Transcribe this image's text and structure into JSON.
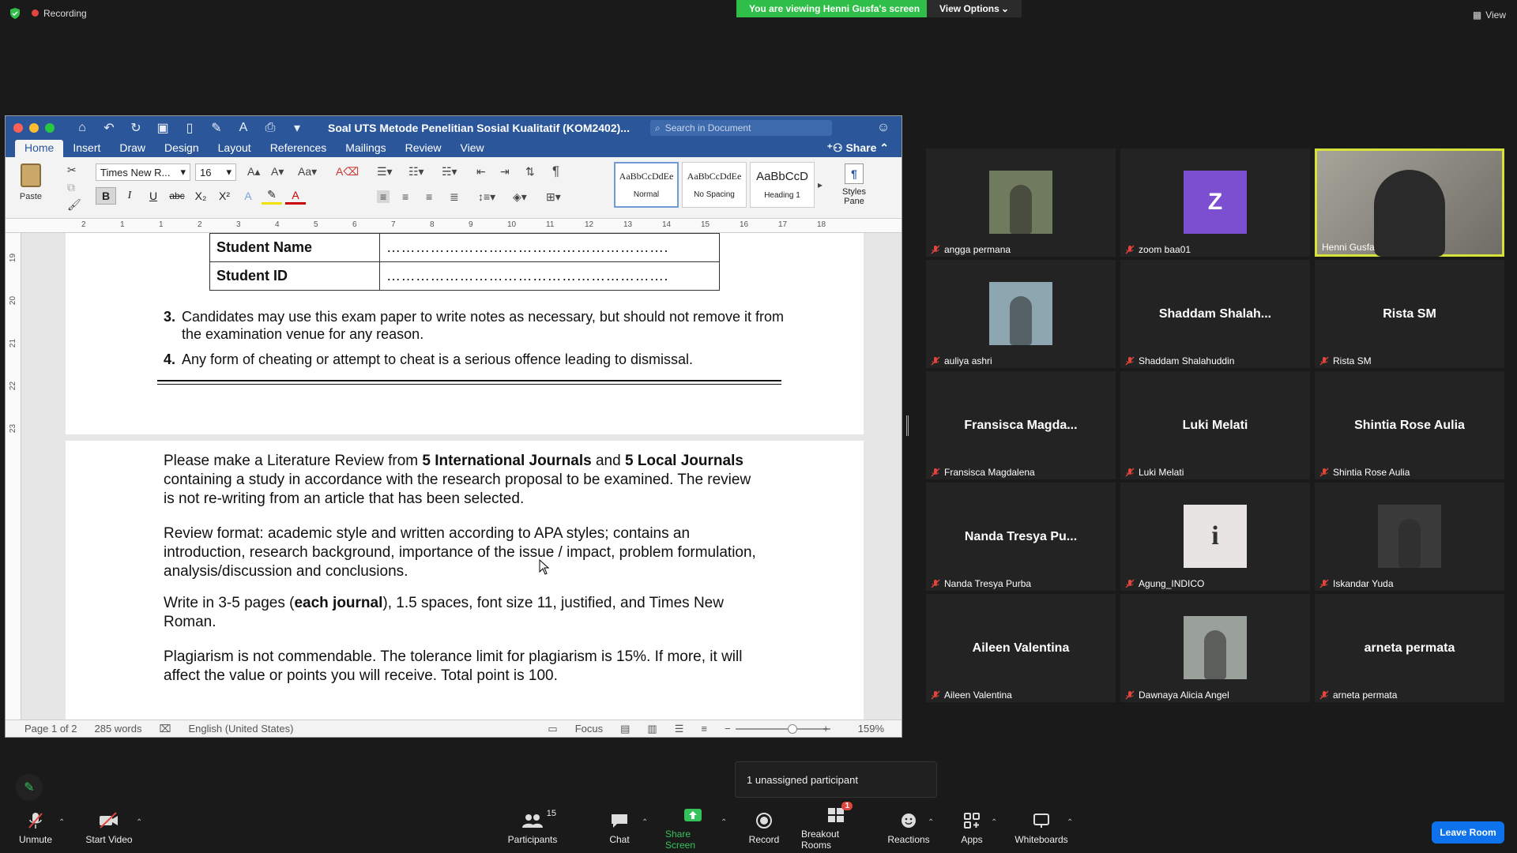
{
  "zoom": {
    "recording_label": "Recording",
    "viewing_banner": "You are viewing Henni Gusfa's screen",
    "view_options": "View Options",
    "view_label": "View",
    "popup": "1 unassigned participant",
    "leave_room": "Leave Room",
    "toolbar": {
      "unmute": "Unmute",
      "start_video": "Start Video",
      "participants": "Participants",
      "participants_count": "15",
      "chat": "Chat",
      "share_screen": "Share Screen",
      "record": "Record",
      "breakout_rooms": "Breakout Rooms",
      "breakout_badge": "1",
      "reactions": "Reactions",
      "apps": "Apps",
      "whiteboards": "Whiteboards"
    },
    "participants": [
      {
        "name": "angga permana",
        "display": "",
        "kind": "photo",
        "color": "#6f7a5e"
      },
      {
        "name": "zoom baa01",
        "display": "Z",
        "kind": "initial",
        "color": "#7b4fcf"
      },
      {
        "name": "Henni Gusfa",
        "display": "",
        "kind": "video",
        "color": "#8c8c86"
      },
      {
        "name": "auliya ashri",
        "display": "",
        "kind": "photo",
        "color": "#8da6b0"
      },
      {
        "name": "Shaddam Shalahuddin",
        "display": "Shaddam  Shalah...",
        "kind": "text"
      },
      {
        "name": "Rista SM",
        "display": "Rista SM",
        "kind": "text"
      },
      {
        "name": "Fransisca Magdalena",
        "display": "Fransisca  Magda...",
        "kind": "text"
      },
      {
        "name": "Luki Melati",
        "display": "Luki Melati",
        "kind": "text"
      },
      {
        "name": "Shintia Rose Aulia",
        "display": "Shintia Rose Aulia",
        "kind": "text"
      },
      {
        "name": "Nanda Tresya Purba",
        "display": "Nanda Tresya Pu...",
        "kind": "text"
      },
      {
        "name": "Agung_INDICO",
        "display": "i",
        "kind": "logo",
        "color": "#e9e4e4"
      },
      {
        "name": "Iskandar Yuda",
        "display": "",
        "kind": "photo",
        "color": "#3a3a3a"
      },
      {
        "name": "Aileen Valentina",
        "display": "Aileen Valentina",
        "kind": "text"
      },
      {
        "name": "Dawnaya Alicia Angel",
        "display": "",
        "kind": "photo",
        "color": "#9aa19a"
      },
      {
        "name": "arneta permata",
        "display": "arneta permata",
        "kind": "text"
      }
    ]
  },
  "word": {
    "title": "Soal UTS Metode Penelitian Sosial Kualitatif (KOM2402)...",
    "search_placeholder": "Search in Document",
    "share": "Share",
    "tabs": [
      "Home",
      "Insert",
      "Draw",
      "Design",
      "Layout",
      "References",
      "Mailings",
      "Review",
      "View"
    ],
    "paste": "Paste",
    "font_name": "Times New R...",
    "font_size": "16",
    "styles": [
      {
        "sample": "AaBbCcDdEe",
        "name": "Normal"
      },
      {
        "sample": "AaBbCcDdEe",
        "name": "No Spacing"
      },
      {
        "sample": "AaBbCcD",
        "name": "Heading 1"
      }
    ],
    "styles_pane": "Styles Pane",
    "ruler_numbers": [
      "2",
      "1",
      "1",
      "2",
      "3",
      "4",
      "5",
      "6",
      "7",
      "8",
      "9",
      "10",
      "11",
      "12",
      "13",
      "14",
      "15",
      "16",
      "17",
      "18"
    ],
    "vruler_numbers": [
      "19",
      "20",
      "21",
      "22",
      "23"
    ],
    "status": {
      "page": "Page 1 of 2",
      "words": "285 words",
      "language": "English (United States)",
      "focus": "Focus",
      "zoom": "159%"
    },
    "doc": {
      "student_name_label": "Student Name",
      "student_id_label": "Student ID",
      "dots": "………………………………………………….",
      "item3_num": "3.",
      "item3_text": "Candidates may use this exam paper to write notes as necessary, but should not remove it from the examination venue for any reason.",
      "item4_num": "4.",
      "item4_text": "Any form of cheating or attempt to cheat is a serious offence leading to dismissal.",
      "p1_a": "Please make a Literature Review from ",
      "p1_b": "5 International Journals",
      "p1_c": " and ",
      "p1_d": "5 Local Journals",
      "p1_e": " containing a study in accordance with the research proposal to be examined. The review is not re-writing from an article that has been selected.",
      "p2": "Review format: academic style and written according to APA styles; contains an introduction, research background, importance of the issue / impact, problem formulation, analysis/discussion and conclusions.",
      "p3_a": "Write in 3-5 pages (",
      "p3_b": "each journal",
      "p3_c": "), 1.5 spaces, font size 11, justified, and Times New Roman.",
      "p4": "Plagiarism is not commendable. The tolerance limit for plagiarism is 15%. If more, it will affect the value or points you will receive. Total point is 100."
    }
  }
}
